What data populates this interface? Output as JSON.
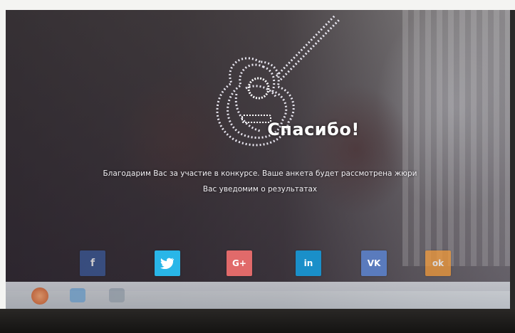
{
  "dialog": {
    "title": "Спасибо!",
    "message_line1": "Благодарим Вас за участие в конкурсе. Ваше анкета будет рассмотрена жюри",
    "message_line2": "Вас уведомим о результатах"
  },
  "social": {
    "facebook": "f",
    "twitter": "t",
    "googleplus": "G+",
    "linkedin": "in",
    "vk": "VK",
    "odnoklassniki": "ok"
  },
  "icons": {
    "logo": "guitar-icon",
    "facebook": "facebook-icon",
    "twitter": "twitter-icon",
    "googleplus": "googleplus-icon",
    "linkedin": "linkedin-icon",
    "vk": "vk-icon",
    "odnoklassniki": "odnoklassniki-icon"
  },
  "colors": {
    "facebook": "#3b5998",
    "twitter": "#29b6e8",
    "googleplus": "#e16a6a",
    "linkedin": "#1a8fc9",
    "vk": "#5a7bbd",
    "odnoklassniki": "#f29a3a",
    "taskbar": "#c4c8cf"
  }
}
